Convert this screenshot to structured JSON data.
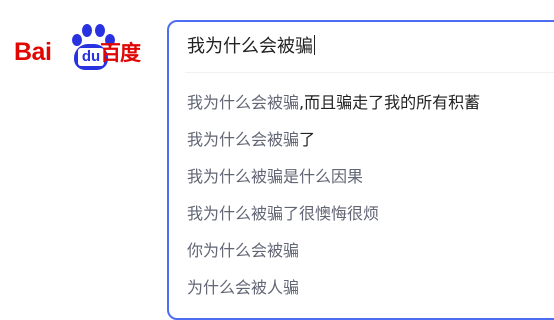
{
  "logo": {
    "latin": "Bai",
    "paw_text": "du",
    "chinese": "百度",
    "colors": {
      "red": "#e10602",
      "blue": "#2932e1"
    }
  },
  "search": {
    "value": "我为什么会被骗",
    "accent_color": "#4e6ef2"
  },
  "suggestions": [
    {
      "prefix": "我为什么会被骗",
      "rest": ",而且骗走了我的所有积蓄"
    },
    {
      "prefix": "我为什么会被骗",
      "rest": "了"
    },
    {
      "prefix": "我为什么被骗是什么因果",
      "rest": ""
    },
    {
      "prefix": "我为什么被骗了很懊悔很烦",
      "rest": ""
    },
    {
      "prefix": "你为什么会被骗",
      "rest": ""
    },
    {
      "prefix": "为什么会被人骗",
      "rest": ""
    }
  ]
}
